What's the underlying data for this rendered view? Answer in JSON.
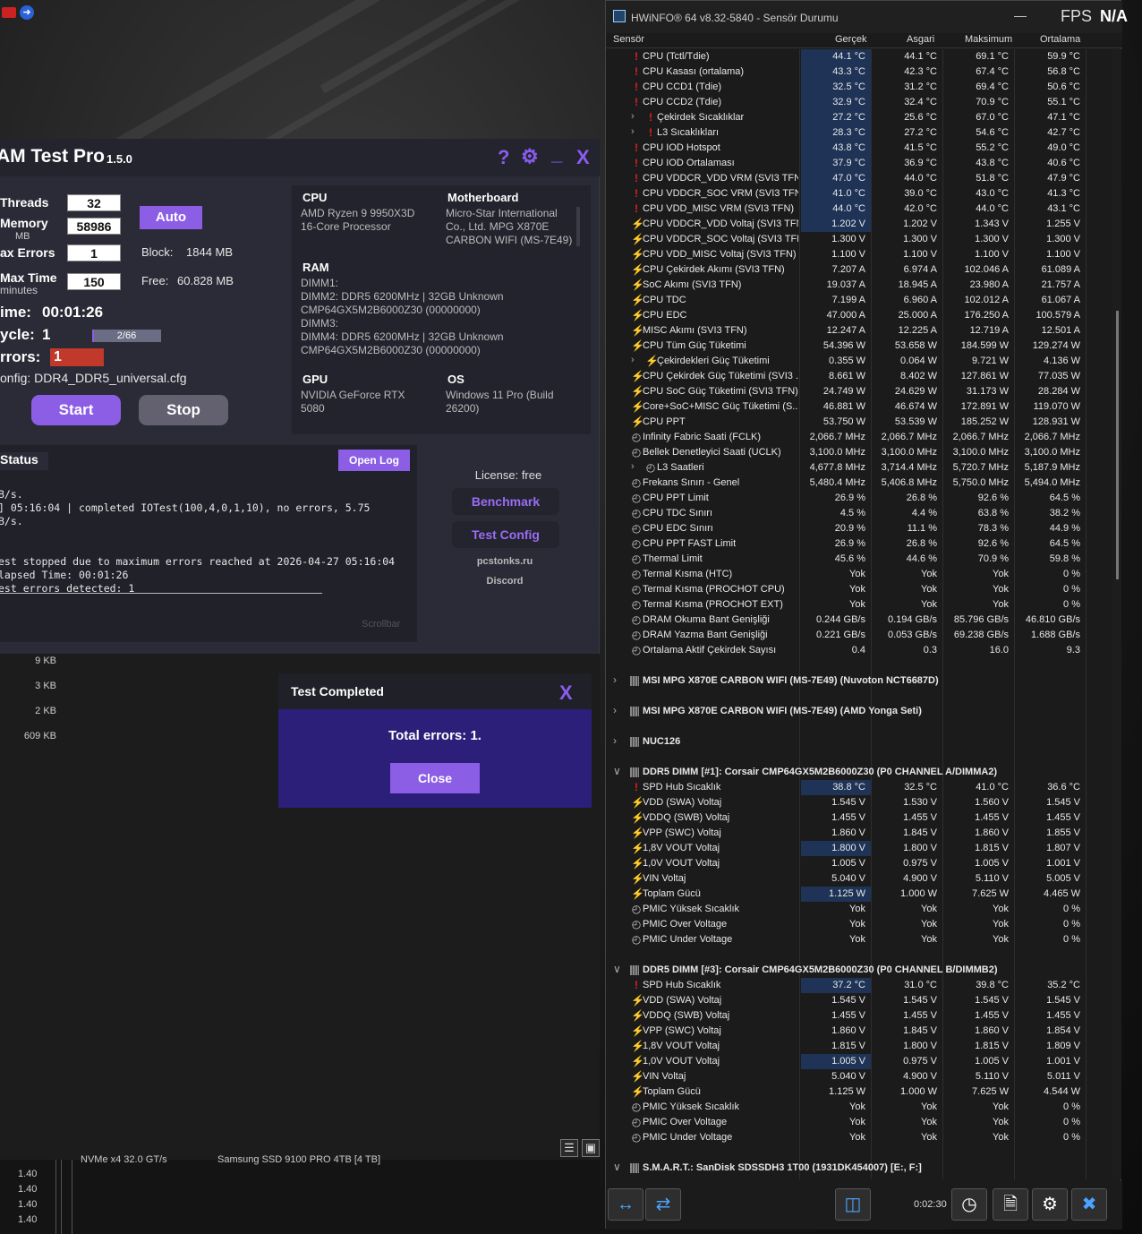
{
  "ramtest": {
    "title": "AM Test Pro",
    "version": "1.5.0",
    "help_label": "?",
    "minimize_label": "_",
    "close_label": "X",
    "threads_label": "Threads",
    "threads_value": "32",
    "memory_label": "Memory",
    "memory_unit": "MB",
    "memory_value": "58986",
    "auto_label": "Auto",
    "max_errors_label": "ax Errors",
    "max_errors_value": "1",
    "block_label": "Block:",
    "block_value": "1844 MB",
    "max_time_label": "Max Time",
    "max_time_unit": "minutes",
    "max_time_value": "150",
    "free_label": "Free:",
    "free_value": "60.828 MB",
    "time_label": "ime:",
    "time_value": "00:01:26",
    "cycle_label": "ycle:",
    "cycle_value": "1",
    "cycle_progress_text": "2/66",
    "cycle_progress": 0.03,
    "errors_label": "rrors:",
    "errors_value": "1",
    "config_text": "onfig: DDR4_DDR5_universal.cfg",
    "start_label": "Start",
    "stop_label": "Stop",
    "cpu_title": "CPU",
    "cpu_text": "AMD Ryzen 9 9950X3D\n16-Core Processor",
    "mb_title": "Motherboard",
    "mb_text": "Micro-Star International\nCo., Ltd. MPG X870E\nCARBON WIFI (MS-7E49)",
    "ram_title": "RAM",
    "ram_text": "DIMM1:\nDIMM2: DDR5 6200MHz | 32GB Unknown\nCMP64GX5M2B6000Z30 (00000000)\nDIMM3:\nDIMM4: DDR5 6200MHz | 32GB Unknown\nCMP64GX5M2B6000Z30 (00000000)",
    "gpu_title": "GPU",
    "gpu_text": "NVIDIA GeForce RTX\n5080",
    "os_title": "OS",
    "os_text": "Windows 11 Pro (Build\n26200)",
    "status_title": "Status",
    "open_log_label": "Open Log",
    "log_text": "B/s.\n] 05:16:04 | completed IOTest(100,4,0,1,10), no errors, 5.75\nB/s.\n\n\nest stopped due to maximum errors reached at 2026-04-27 05:16:04\nlapsed Time: 00:01:26\nest errors detected: 1",
    "license_text": "License: free",
    "benchmark_label": "Benchmark",
    "test_config_label": "Test Config",
    "site_text": "pcstonks.ru",
    "discord_text": "Discord",
    "scrollbar_text": "Scrollbar"
  },
  "lower": {
    "sizes": [
      "9 KB",
      "3 KB",
      "2 KB",
      "609 KB"
    ],
    "nvme_text": "NVMe x4 32.0 GT/s",
    "ssd_text": "Samsung SSD 9100 PRO 4TB [4 TB]",
    "numbers": [
      "1.40",
      "1.40",
      "1.40",
      "1.40",
      "1.40"
    ]
  },
  "dialog": {
    "title": "Test Completed",
    "close_x": "X",
    "message": "Total errors: 1.",
    "close_label": "Close"
  },
  "hwinfo": {
    "title": "HWiNFO® 64 v8.32-5840 - Sensör Durumu",
    "fps_label": "FPS",
    "fps_value": "N/A",
    "minimize_label": "—",
    "columns": {
      "sensor": "Sensör",
      "current": "Gerçek",
      "min": "Asgari",
      "max": "Maksimum",
      "avg": "Ortalama"
    },
    "timer": "0:02:30",
    "rows": [
      {
        "type": "item",
        "icon": "t",
        "name": "CPU (Tctl/Tdie)",
        "v": [
          "44.1 °C",
          "44.1 °C",
          "69.1 °C",
          "59.9 °C"
        ],
        "hl": true
      },
      {
        "type": "item",
        "icon": "t",
        "name": "CPU Kasası (ortalama)",
        "v": [
          "43.3 °C",
          "42.3 °C",
          "67.4 °C",
          "56.8 °C"
        ],
        "hl": true
      },
      {
        "type": "item",
        "icon": "t",
        "name": "CPU CCD1 (Tdie)",
        "v": [
          "32.5 °C",
          "31.2 °C",
          "69.4 °C",
          "50.6 °C"
        ],
        "hl": true
      },
      {
        "type": "item",
        "icon": "t",
        "name": "CPU CCD2 (Tdie)",
        "v": [
          "32.9 °C",
          "32.4 °C",
          "70.9 °C",
          "55.1 °C"
        ],
        "hl": true
      },
      {
        "type": "sub",
        "icon": "t",
        "name": "Çekirdek Sıcaklıklar",
        "v": [
          "27.2 °C",
          "25.6 °C",
          "67.0 °C",
          "47.1 °C"
        ],
        "hl": true
      },
      {
        "type": "sub",
        "icon": "t",
        "name": "L3 Sıcaklıkları",
        "v": [
          "28.3 °C",
          "27.2 °C",
          "54.6 °C",
          "42.7 °C"
        ],
        "hl": true
      },
      {
        "type": "item",
        "icon": "t",
        "name": "CPU IOD Hotspot",
        "v": [
          "43.8 °C",
          "41.5 °C",
          "55.2 °C",
          "49.0 °C"
        ],
        "hl": true
      },
      {
        "type": "item",
        "icon": "t",
        "name": "CPU IOD Ortalaması",
        "v": [
          "37.9 °C",
          "36.9 °C",
          "43.8 °C",
          "40.6 °C"
        ],
        "hl": true
      },
      {
        "type": "item",
        "icon": "t",
        "name": "CPU VDDCR_VDD VRM (SVI3 TFN)",
        "v": [
          "47.0 °C",
          "44.0 °C",
          "51.8 °C",
          "47.9 °C"
        ],
        "hl": true
      },
      {
        "type": "item",
        "icon": "t",
        "name": "CPU VDDCR_SOC VRM (SVI3 TFN)",
        "v": [
          "41.0 °C",
          "39.0 °C",
          "43.0 °C",
          "41.3 °C"
        ],
        "hl": true
      },
      {
        "type": "item",
        "icon": "t",
        "name": "CPU VDD_MISC VRM (SVI3 TFN)",
        "v": [
          "44.0 °C",
          "42.0 °C",
          "44.0 °C",
          "43.1 °C"
        ],
        "hl": true
      },
      {
        "type": "item",
        "icon": "v",
        "name": "CPU VDDCR_VDD Voltaj (SVI3 TFN)",
        "v": [
          "1.202 V",
          "1.202 V",
          "1.343 V",
          "1.255 V"
        ],
        "hl": true
      },
      {
        "type": "item",
        "icon": "v",
        "name": "CPU VDDCR_SOC Voltaj (SVI3 TFN)",
        "v": [
          "1.300 V",
          "1.300 V",
          "1.300 V",
          "1.300 V"
        ],
        "hl": false
      },
      {
        "type": "item",
        "icon": "v",
        "name": "CPU VDD_MISC Voltaj (SVI3 TFN)",
        "v": [
          "1.100 V",
          "1.100 V",
          "1.100 V",
          "1.100 V"
        ],
        "hl": false
      },
      {
        "type": "item",
        "icon": "v",
        "name": "CPU Çekirdek Akımı (SVI3 TFN)",
        "v": [
          "7.207 A",
          "6.974 A",
          "102.046 A",
          "61.089 A"
        ],
        "hl": false
      },
      {
        "type": "item",
        "icon": "v",
        "name": "SoC Akımı (SVI3 TFN)",
        "v": [
          "19.037 A",
          "18.945 A",
          "23.980 A",
          "21.757 A"
        ],
        "hl": false
      },
      {
        "type": "item",
        "icon": "v",
        "name": "CPU TDC",
        "v": [
          "7.199 A",
          "6.960 A",
          "102.012 A",
          "61.067 A"
        ],
        "hl": false
      },
      {
        "type": "item",
        "icon": "v",
        "name": "CPU EDC",
        "v": [
          "47.000 A",
          "25.000 A",
          "176.250 A",
          "100.579 A"
        ],
        "hl": false
      },
      {
        "type": "item",
        "icon": "v",
        "name": "MISC Akımı (SVI3 TFN)",
        "v": [
          "12.247 A",
          "12.225 A",
          "12.719 A",
          "12.501 A"
        ],
        "hl": false
      },
      {
        "type": "item",
        "icon": "v",
        "name": "CPU Tüm Güç Tüketimi",
        "v": [
          "54.396 W",
          "53.658 W",
          "184.599 W",
          "129.274 W"
        ],
        "hl": false
      },
      {
        "type": "sub",
        "icon": "v",
        "name": "Çekirdekleri Güç Tüketimi",
        "v": [
          "0.355 W",
          "0.064 W",
          "9.721 W",
          "4.136 W"
        ],
        "hl": false
      },
      {
        "type": "item",
        "icon": "v",
        "name": "CPU Çekirdek Güç Tüketimi (SVI3 ...",
        "v": [
          "8.661 W",
          "8.402 W",
          "127.861 W",
          "77.035 W"
        ],
        "hl": false
      },
      {
        "type": "item",
        "icon": "v",
        "name": "CPU SoC Güç Tüketimi (SVI3 TFN)",
        "v": [
          "24.749 W",
          "24.629 W",
          "31.173 W",
          "28.284 W"
        ],
        "hl": false
      },
      {
        "type": "item",
        "icon": "v",
        "name": "Core+SoC+MISC Güç Tüketimi (S...",
        "v": [
          "46.881 W",
          "46.674 W",
          "172.891 W",
          "119.070 W"
        ],
        "hl": false
      },
      {
        "type": "item",
        "icon": "v",
        "name": "CPU PPT",
        "v": [
          "53.750 W",
          "53.539 W",
          "185.252 W",
          "128.931 W"
        ],
        "hl": false
      },
      {
        "type": "item",
        "icon": "c",
        "name": "Infinity Fabric Saati (FCLK)",
        "v": [
          "2,066.7 MHz",
          "2,066.7 MHz",
          "2,066.7 MHz",
          "2,066.7 MHz"
        ],
        "hl": false
      },
      {
        "type": "item",
        "icon": "c",
        "name": "Bellek Denetleyici Saati (UCLK)",
        "v": [
          "3,100.0 MHz",
          "3,100.0 MHz",
          "3,100.0 MHz",
          "3,100.0 MHz"
        ],
        "hl": false
      },
      {
        "type": "sub",
        "icon": "c",
        "name": "L3 Saatleri",
        "v": [
          "4,677.8 MHz",
          "3,714.4 MHz",
          "5,720.7 MHz",
          "5,187.9 MHz"
        ],
        "hl": false
      },
      {
        "type": "item",
        "icon": "c",
        "name": "Frekans Sınırı - Genel",
        "v": [
          "5,480.4 MHz",
          "5,406.8 MHz",
          "5,750.0 MHz",
          "5,494.0 MHz"
        ],
        "hl": false
      },
      {
        "type": "item",
        "icon": "c",
        "name": "CPU PPT Limit",
        "v": [
          "26.9 %",
          "26.8 %",
          "92.6 %",
          "64.5 %"
        ],
        "hl": false
      },
      {
        "type": "item",
        "icon": "c",
        "name": "CPU TDC Sınırı",
        "v": [
          "4.5 %",
          "4.4 %",
          "63.8 %",
          "38.2 %"
        ],
        "hl": false
      },
      {
        "type": "item",
        "icon": "c",
        "name": "CPU EDC Sınırı",
        "v": [
          "20.9 %",
          "11.1 %",
          "78.3 %",
          "44.9 %"
        ],
        "hl": false
      },
      {
        "type": "item",
        "icon": "c",
        "name": "CPU PPT FAST Limit",
        "v": [
          "26.9 %",
          "26.8 %",
          "92.6 %",
          "64.5 %"
        ],
        "hl": false
      },
      {
        "type": "item",
        "icon": "c",
        "name": "Thermal Limit",
        "v": [
          "45.6 %",
          "44.6 %",
          "70.9 %",
          "59.8 %"
        ],
        "hl": false
      },
      {
        "type": "item",
        "icon": "c",
        "name": "Termal Kısma (HTC)",
        "v": [
          "Yok",
          "Yok",
          "Yok",
          "0 %"
        ],
        "hl": false
      },
      {
        "type": "item",
        "icon": "c",
        "name": "Termal Kısma (PROCHOT CPU)",
        "v": [
          "Yok",
          "Yok",
          "Yok",
          "0 %"
        ],
        "hl": false
      },
      {
        "type": "item",
        "icon": "c",
        "name": "Termal Kısma (PROCHOT EXT)",
        "v": [
          "Yok",
          "Yok",
          "Yok",
          "0 %"
        ],
        "hl": false
      },
      {
        "type": "item",
        "icon": "c",
        "name": "DRAM Okuma Bant Genişliği",
        "v": [
          "0.244 GB/s",
          "0.194 GB/s",
          "85.796 GB/s",
          "46.810 GB/s"
        ],
        "hl": false
      },
      {
        "type": "item",
        "icon": "c",
        "name": "DRAM Yazma Bant Genişliği",
        "v": [
          "0.221 GB/s",
          "0.053 GB/s",
          "69.238 GB/s",
          "1.688 GB/s"
        ],
        "hl": false
      },
      {
        "type": "item",
        "icon": "c",
        "name": "Ortalama Aktif Çekirdek Sayısı",
        "v": [
          "0.4",
          "0.3",
          "16.0",
          "9.3"
        ],
        "hl": false
      },
      {
        "type": "blank"
      },
      {
        "type": "group",
        "exp": ">",
        "name": "MSI MPG X870E CARBON WIFI (MS-7E49) (Nuvoton NCT6687D)"
      },
      {
        "type": "blank"
      },
      {
        "type": "group",
        "exp": ">",
        "name": "MSI MPG X870E CARBON WIFI (MS-7E49) (AMD Yonga Seti)"
      },
      {
        "type": "blank"
      },
      {
        "type": "group",
        "exp": ">",
        "name": "NUC126"
      },
      {
        "type": "blank"
      },
      {
        "type": "group",
        "exp": "v",
        "name": "DDR5 DIMM [#1]: Corsair CMP64GX5M2B6000Z30 (P0 CHANNEL A/DIMMA2)"
      },
      {
        "type": "item",
        "icon": "t",
        "name": "SPD Hub Sıcaklık",
        "v": [
          "38.8 °C",
          "32.5 °C",
          "41.0 °C",
          "36.6 °C"
        ],
        "hl": true
      },
      {
        "type": "item",
        "icon": "v",
        "name": "VDD (SWA) Voltaj",
        "v": [
          "1.545 V",
          "1.530 V",
          "1.560 V",
          "1.545 V"
        ],
        "hl": false
      },
      {
        "type": "item",
        "icon": "v",
        "name": "VDDQ (SWB) Voltaj",
        "v": [
          "1.455 V",
          "1.455 V",
          "1.455 V",
          "1.455 V"
        ],
        "hl": false
      },
      {
        "type": "item",
        "icon": "v",
        "name": "VPP (SWC) Voltaj",
        "v": [
          "1.860 V",
          "1.845 V",
          "1.860 V",
          "1.855 V"
        ],
        "hl": false
      },
      {
        "type": "item",
        "icon": "v",
        "name": "1,8V VOUT Voltaj",
        "v": [
          "1.800 V",
          "1.800 V",
          "1.815 V",
          "1.807 V"
        ],
        "hl": true
      },
      {
        "type": "item",
        "icon": "v",
        "name": "1,0V VOUT Voltaj",
        "v": [
          "1.005 V",
          "0.975 V",
          "1.005 V",
          "1.001 V"
        ],
        "hl": false
      },
      {
        "type": "item",
        "icon": "v",
        "name": "VIN Voltaj",
        "v": [
          "5.040 V",
          "4.900 V",
          "5.110 V",
          "5.005 V"
        ],
        "hl": false
      },
      {
        "type": "item",
        "icon": "v",
        "name": "Toplam Gücü",
        "v": [
          "1.125 W",
          "1.000 W",
          "7.625 W",
          "4.465 W"
        ],
        "hl": true
      },
      {
        "type": "item",
        "icon": "c",
        "name": "PMIC Yüksek Sıcaklık",
        "v": [
          "Yok",
          "Yok",
          "Yok",
          "0 %"
        ],
        "hl": false
      },
      {
        "type": "item",
        "icon": "c",
        "name": "PMIC Over Voltage",
        "v": [
          "Yok",
          "Yok",
          "Yok",
          "0 %"
        ],
        "hl": false
      },
      {
        "type": "item",
        "icon": "c",
        "name": "PMIC Under Voltage",
        "v": [
          "Yok",
          "Yok",
          "Yok",
          "0 %"
        ],
        "hl": false
      },
      {
        "type": "blank"
      },
      {
        "type": "group",
        "exp": "v",
        "name": "DDR5 DIMM [#3]: Corsair CMP64GX5M2B6000Z30 (P0 CHANNEL B/DIMMB2)"
      },
      {
        "type": "item",
        "icon": "t",
        "name": "SPD Hub Sıcaklık",
        "v": [
          "37.2 °C",
          "31.0 °C",
          "39.8 °C",
          "35.2 °C"
        ],
        "hl": true
      },
      {
        "type": "item",
        "icon": "v",
        "name": "VDD (SWA) Voltaj",
        "v": [
          "1.545 V",
          "1.545 V",
          "1.545 V",
          "1.545 V"
        ],
        "hl": false
      },
      {
        "type": "item",
        "icon": "v",
        "name": "VDDQ (SWB) Voltaj",
        "v": [
          "1.455 V",
          "1.455 V",
          "1.455 V",
          "1.455 V"
        ],
        "hl": false
      },
      {
        "type": "item",
        "icon": "v",
        "name": "VPP (SWC) Voltaj",
        "v": [
          "1.860 V",
          "1.845 V",
          "1.860 V",
          "1.854 V"
        ],
        "hl": false
      },
      {
        "type": "item",
        "icon": "v",
        "name": "1,8V VOUT Voltaj",
        "v": [
          "1.815 V",
          "1.800 V",
          "1.815 V",
          "1.809 V"
        ],
        "hl": false
      },
      {
        "type": "item",
        "icon": "v",
        "name": "1,0V VOUT Voltaj",
        "v": [
          "1.005 V",
          "0.975 V",
          "1.005 V",
          "1.001 V"
        ],
        "hl": true
      },
      {
        "type": "item",
        "icon": "v",
        "name": "VIN Voltaj",
        "v": [
          "5.040 V",
          "4.900 V",
          "5.110 V",
          "5.011 V"
        ],
        "hl": false
      },
      {
        "type": "item",
        "icon": "v",
        "name": "Toplam Gücü",
        "v": [
          "1.125 W",
          "1.000 W",
          "7.625 W",
          "4.544 W"
        ],
        "hl": false
      },
      {
        "type": "item",
        "icon": "c",
        "name": "PMIC Yüksek Sıcaklık",
        "v": [
          "Yok",
          "Yok",
          "Yok",
          "0 %"
        ],
        "hl": false
      },
      {
        "type": "item",
        "icon": "c",
        "name": "PMIC Over Voltage",
        "v": [
          "Yok",
          "Yok",
          "Yok",
          "0 %"
        ],
        "hl": false
      },
      {
        "type": "item",
        "icon": "c",
        "name": "PMIC Under Voltage",
        "v": [
          "Yok",
          "Yok",
          "Yok",
          "0 %"
        ],
        "hl": false
      },
      {
        "type": "blank"
      },
      {
        "type": "group",
        "exp": "v",
        "name": "S.M.A.R.T.: SanDisk SDSSDH3 1T00 (1931DK454007) [E:, F:]"
      }
    ]
  },
  "colors": {
    "accent": "#8c5ee6",
    "error": "#c0392b",
    "hw_highlight": "#1e3356"
  }
}
